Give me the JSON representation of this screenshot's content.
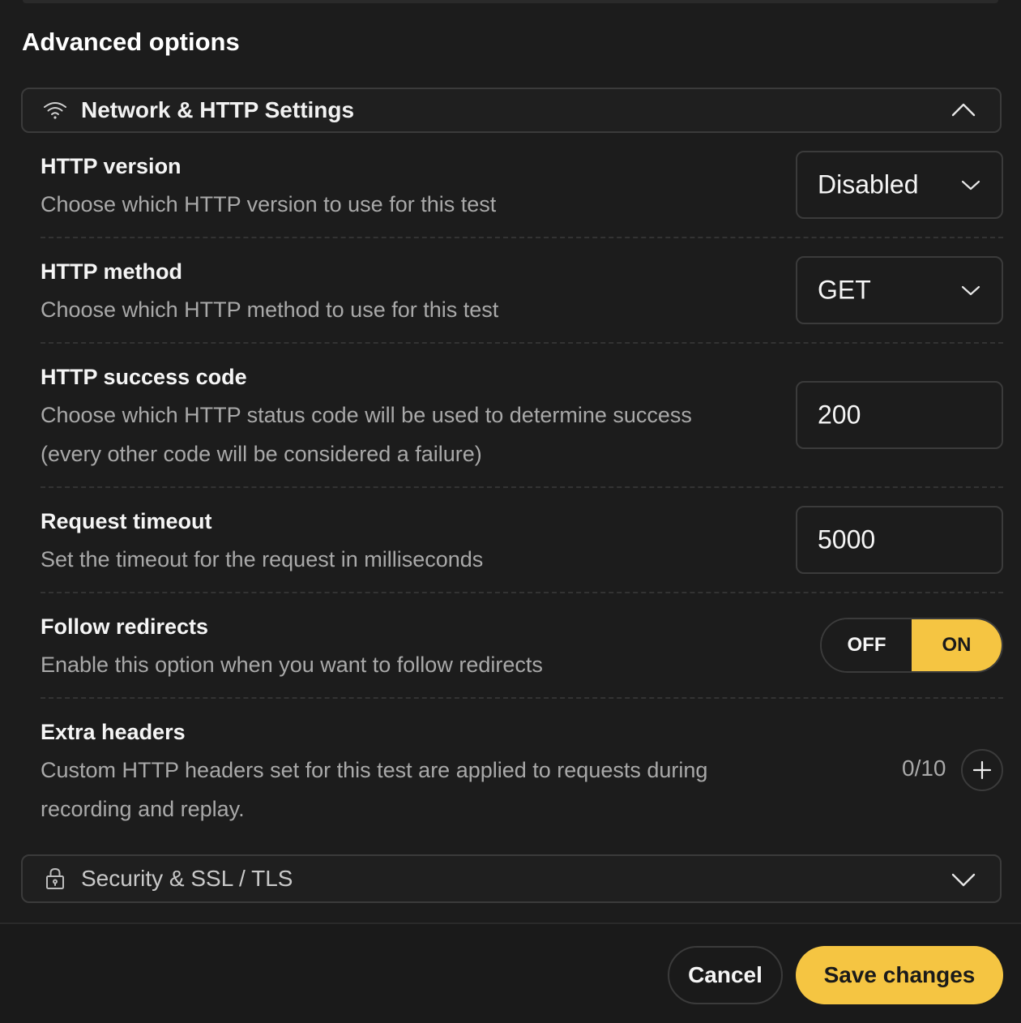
{
  "title": "Advanced options",
  "sections": {
    "network": {
      "label": "Network & HTTP Settings",
      "icon": "wifi-icon",
      "expanded": true
    },
    "security": {
      "label": "Security & SSL / TLS",
      "icon": "lock-icon",
      "expanded": false
    }
  },
  "settings": {
    "http_version": {
      "label": "HTTP version",
      "description": "Choose which HTTP version to use for this test",
      "value": "Disabled"
    },
    "http_method": {
      "label": "HTTP method",
      "description": "Choose which HTTP method to use for this test",
      "value": "GET"
    },
    "success_code": {
      "label": "HTTP success code",
      "description_line1": "Choose which HTTP status code will be used to determine success",
      "description_line2": "(every other code will be considered a failure)",
      "value": "200"
    },
    "request_timeout": {
      "label": "Request timeout",
      "description": "Set the timeout for the request in milliseconds",
      "value": "5000"
    },
    "follow_redirects": {
      "label": "Follow redirects",
      "description": "Enable this option when you want to follow redirects",
      "off_label": "OFF",
      "on_label": "ON",
      "selected": "ON"
    },
    "extra_headers": {
      "label": "Extra headers",
      "description_line1": "Custom HTTP headers set for this test are applied to requests during",
      "description_line2": "recording and replay.",
      "count": "0/10"
    }
  },
  "footer": {
    "cancel_label": "Cancel",
    "save_label": "Save changes"
  },
  "colors": {
    "background": "#1c1c1c",
    "accent": "#f5c542",
    "border": "#3b3b3b",
    "muted_text": "#a9a9a9"
  }
}
